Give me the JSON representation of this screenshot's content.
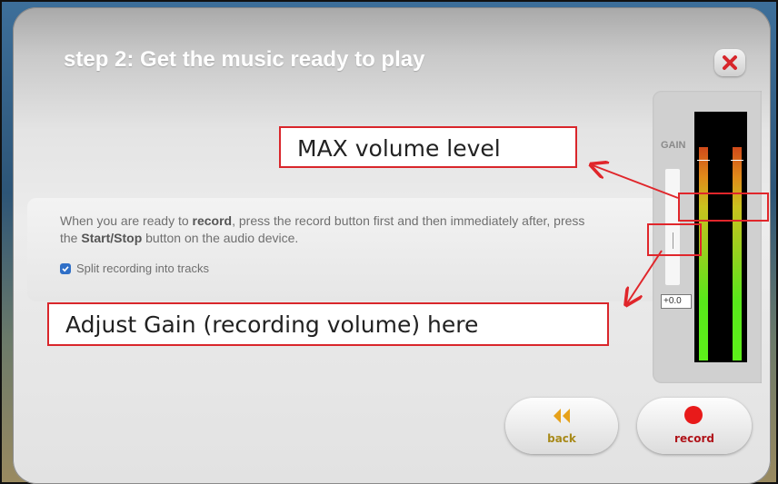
{
  "dialog": {
    "title": "step 2: Get the music ready to play",
    "close_icon": "close-x-icon"
  },
  "instructions": {
    "part1": "When you are ready to ",
    "record_word": "record",
    "part2": ", press the record button first and then immediately after, press the ",
    "startstop_word": "Start/Stop",
    "part3": " button on the audio device."
  },
  "checkbox": {
    "label": "Split recording into tracks",
    "checked": true
  },
  "meter": {
    "gain_label": "GAIN",
    "gain_value": "+0.0",
    "level_fraction": 0.87
  },
  "buttons": {
    "back_label": "back",
    "record_label": "record",
    "back_icon": "rewind-icon",
    "record_icon": "record-dot-icon"
  },
  "annotations": {
    "max_volume": "MAX volume level",
    "adjust_gain": "Adjust Gain (recording volume) here"
  },
  "colors": {
    "accent_red": "#e0262b",
    "back_arrow": "#e6a11a",
    "record_dot": "#e81a1a",
    "checkbox_blue": "#2f6fc7"
  }
}
